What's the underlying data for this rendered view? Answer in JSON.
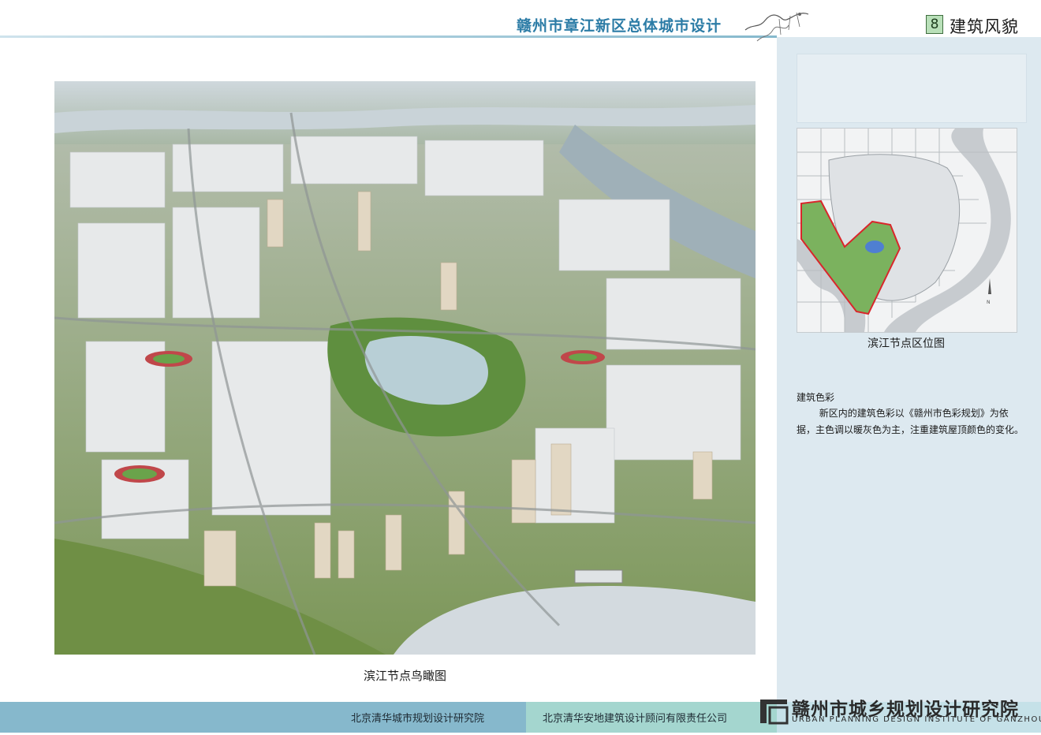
{
  "header": {
    "title": "赣州市章江新区总体城市设计",
    "section_number": "8",
    "section_title": "建筑风貌"
  },
  "main": {
    "aerial_caption": "滨江节点鸟瞰图"
  },
  "side": {
    "map_caption": "滨江节点区位图",
    "color_heading": "建筑色彩",
    "color_text": "新区内的建筑色彩以《赣州市色彩规划》为依据，主色调以暖灰色为主，注重建筑屋顶颜色的变化。"
  },
  "footer": {
    "left_org": "北京清华城市规划设计研究院",
    "mid_org": "北京清华安地建筑设计顾问有限责任公司",
    "right_org": "赣州市城乡规划设计研究院",
    "right_org_en": "URBAN PLANNING DESIGN INSTITUTE OF GANZHOU"
  },
  "colors": {
    "header_text": "#2c7ca6",
    "side_panel": "#dde9f0",
    "footer_left": "#86b8cc",
    "footer_mid": "#a4d6cf",
    "footer_right": "#c5e1e8"
  }
}
